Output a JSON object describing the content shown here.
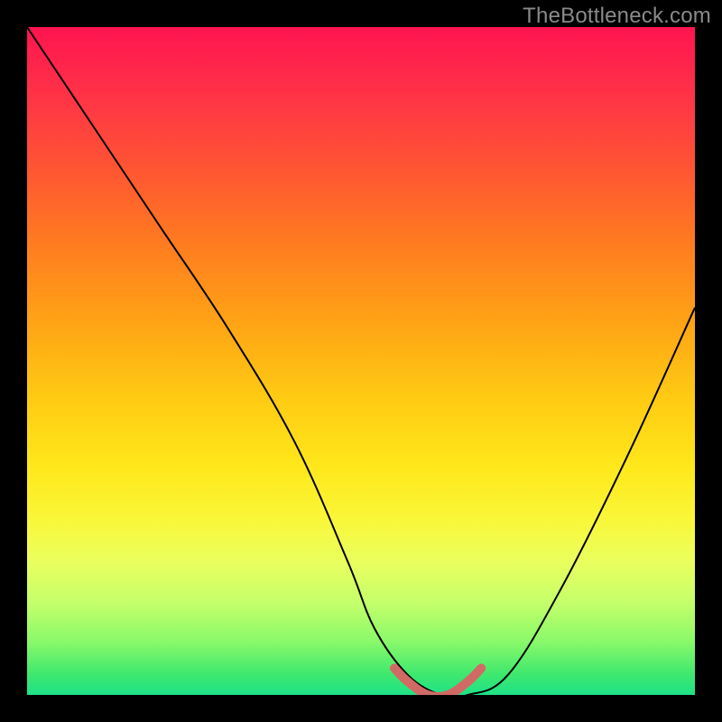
{
  "watermark": "TheBottleneck.com",
  "chart_data": {
    "type": "line",
    "title": "",
    "xlabel": "",
    "ylabel": "",
    "xlim": [
      0,
      100
    ],
    "ylim": [
      0,
      100
    ],
    "grid": false,
    "series": [
      {
        "name": "curve",
        "x": [
          0,
          10,
          20,
          30,
          40,
          48,
          52,
          57,
          62,
          66,
          72,
          80,
          90,
          100
        ],
        "values": [
          100,
          85,
          70,
          55,
          38,
          20,
          10,
          3,
          0,
          0,
          3,
          16,
          36,
          58
        ]
      },
      {
        "name": "highlight",
        "x": [
          55,
          57,
          60,
          63,
          66,
          68
        ],
        "values": [
          4,
          2,
          0,
          0,
          2,
          4
        ]
      }
    ],
    "background_gradient": {
      "direction": "vertical",
      "stops": [
        {
          "pos": 0.0,
          "color": "#ff1450"
        },
        {
          "pos": 0.2,
          "color": "#ff5135"
        },
        {
          "pos": 0.44,
          "color": "#ffa315"
        },
        {
          "pos": 0.66,
          "color": "#ffe81b"
        },
        {
          "pos": 0.86,
          "color": "#c6ff6a"
        },
        {
          "pos": 1.0,
          "color": "#1ee288"
        }
      ]
    }
  }
}
